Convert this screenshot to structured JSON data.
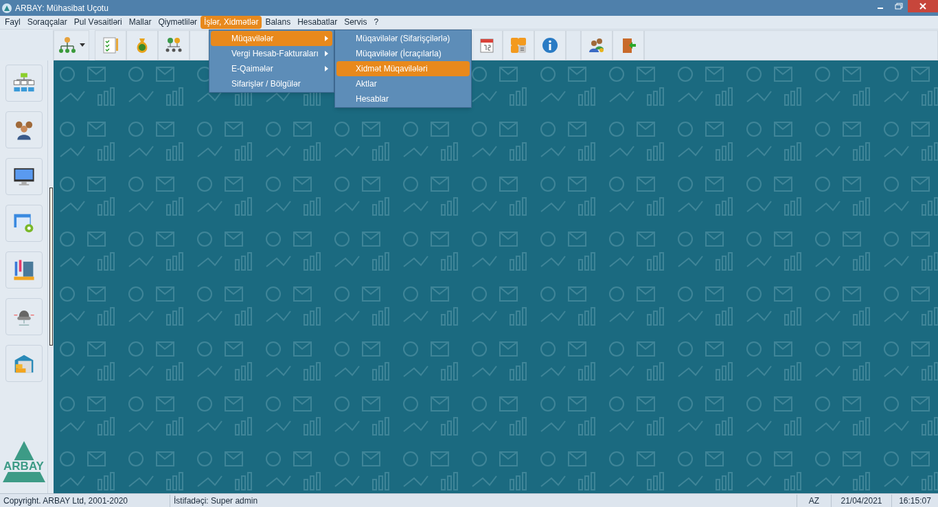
{
  "window": {
    "title": "ARBAY: Mühasibat Uçotu"
  },
  "menu_bar": [
    {
      "label": "Fayl",
      "selected": false
    },
    {
      "label": "Soraqçalar",
      "selected": false
    },
    {
      "label": "Pul Vəsaitləri",
      "selected": false
    },
    {
      "label": "Mallar",
      "selected": false
    },
    {
      "label": "Qiymətlilər",
      "selected": false
    },
    {
      "label": "İşlər, Xidmətlər",
      "selected": true
    },
    {
      "label": "Balans",
      "selected": false
    },
    {
      "label": "Hesabatlar",
      "selected": false
    },
    {
      "label": "Servis",
      "selected": false
    },
    {
      "label": "?",
      "selected": false
    }
  ],
  "dropdown": [
    {
      "label": "Müqavilələr",
      "selected": true,
      "has_submenu": true
    },
    {
      "label": "Vergi Hesab-Fakturaları",
      "selected": false,
      "has_submenu": true
    },
    {
      "label": "E-Qaimələr",
      "selected": false,
      "has_submenu": true
    },
    {
      "label": "Sifarişlər / Bölgülər",
      "selected": false,
      "has_submenu": false
    }
  ],
  "submenu": [
    {
      "label": "Müqavilələr (Sifarişçilərlə)",
      "selected": false
    },
    {
      "label": "Müqavilələr (İcraçılarla)",
      "selected": false
    },
    {
      "label": "Xidmət Müqavilələri",
      "selected": true
    },
    {
      "label": "Aktlar",
      "selected": false
    },
    {
      "label": "Hesablar",
      "selected": false
    }
  ],
  "logo": {
    "text": "ARBAY"
  },
  "status_bar": {
    "copyright": "Copyright. ARBAY Ltd, 2001-2020",
    "user": "İstifadəçi: Super admin",
    "language": "AZ",
    "date": "21/04/2021",
    "time": "16:15:07"
  }
}
